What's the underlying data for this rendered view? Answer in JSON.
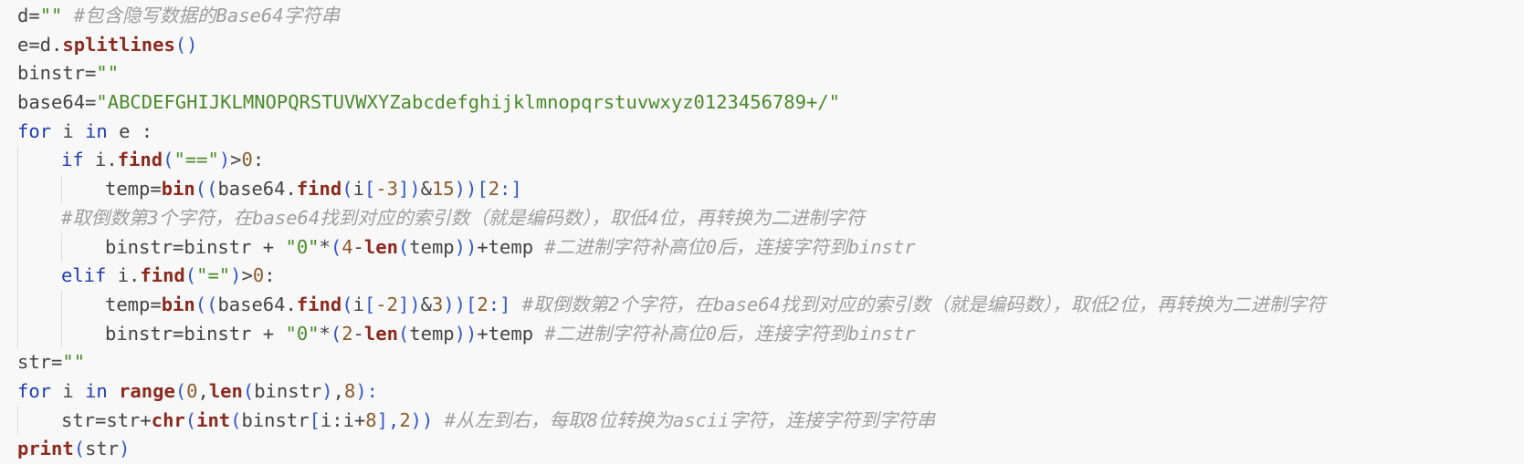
{
  "colors": {
    "background": "#f8f8f8",
    "keyword": "#1f3fb0",
    "function": "#8b2a1e",
    "string": "#4a8a2a",
    "number": "#8b5a2b",
    "comment": "#9e9e9e",
    "default": "#444444",
    "indent_guide": "#dcdcdc"
  },
  "lines": [
    {
      "indent": 0,
      "tokens": [
        {
          "t": "d=",
          "c": "default"
        },
        {
          "t": "\"\"",
          "c": "str"
        },
        {
          "t": " #包含隐写数据的Base64字符串",
          "c": "comment"
        }
      ]
    },
    {
      "indent": 0,
      "tokens": [
        {
          "t": "e=d.",
          "c": "default"
        },
        {
          "t": "splitlines",
          "c": "fn"
        },
        {
          "t": "()",
          "c": "paren"
        }
      ]
    },
    {
      "indent": 0,
      "tokens": [
        {
          "t": "binstr=",
          "c": "default"
        },
        {
          "t": "\"\"",
          "c": "str"
        }
      ]
    },
    {
      "indent": 0,
      "tokens": [
        {
          "t": "base64=",
          "c": "default"
        },
        {
          "t": "\"ABCDEFGHIJKLMNOPQRSTUVWXYZabcdefghijklmnopqrstuvwxyz0123456789+/\"",
          "c": "str"
        }
      ]
    },
    {
      "indent": 0,
      "tokens": [
        {
          "t": "for",
          "c": "kw"
        },
        {
          "t": " i ",
          "c": "default"
        },
        {
          "t": "in",
          "c": "kw"
        },
        {
          "t": " e :",
          "c": "default"
        }
      ]
    },
    {
      "indent": 1,
      "tokens": [
        {
          "t": "if",
          "c": "kw"
        },
        {
          "t": " i.",
          "c": "default"
        },
        {
          "t": "find",
          "c": "fn"
        },
        {
          "t": "(",
          "c": "paren"
        },
        {
          "t": "\"==\"",
          "c": "str"
        },
        {
          "t": ")",
          "c": "paren"
        },
        {
          "t": ">",
          "c": "default"
        },
        {
          "t": "0",
          "c": "num"
        },
        {
          "t": ":",
          "c": "default"
        }
      ]
    },
    {
      "indent": 2,
      "tokens": [
        {
          "t": "temp=",
          "c": "default"
        },
        {
          "t": "bin",
          "c": "builtin"
        },
        {
          "t": "((",
          "c": "paren"
        },
        {
          "t": "base64.",
          "c": "default"
        },
        {
          "t": "find",
          "c": "fn"
        },
        {
          "t": "(",
          "c": "paren"
        },
        {
          "t": "i",
          "c": "default"
        },
        {
          "t": "[",
          "c": "paren"
        },
        {
          "t": "-3",
          "c": "num"
        },
        {
          "t": "])",
          "c": "paren"
        },
        {
          "t": "&",
          "c": "default"
        },
        {
          "t": "15",
          "c": "num"
        },
        {
          "t": "))",
          "c": "paren"
        },
        {
          "t": "[",
          "c": "paren"
        },
        {
          "t": "2",
          "c": "num"
        },
        {
          "t": ":]",
          "c": "paren"
        }
      ]
    },
    {
      "indent": 1,
      "tokens": [
        {
          "t": "#取倒数第3个字符，在base64找到对应的索引数（就是编码数），取低4位，再转换为二进制字符",
          "c": "comment"
        }
      ]
    },
    {
      "indent": 2,
      "tokens": [
        {
          "t": "binstr=binstr + ",
          "c": "default"
        },
        {
          "t": "\"0\"",
          "c": "str"
        },
        {
          "t": "*",
          "c": "default"
        },
        {
          "t": "(",
          "c": "paren"
        },
        {
          "t": "4",
          "c": "num"
        },
        {
          "t": "-",
          "c": "default"
        },
        {
          "t": "len",
          "c": "builtin"
        },
        {
          "t": "(",
          "c": "paren"
        },
        {
          "t": "temp",
          "c": "default"
        },
        {
          "t": "))",
          "c": "paren"
        },
        {
          "t": "+temp ",
          "c": "default"
        },
        {
          "t": "#二进制字符补高位0后，连接字符到binstr",
          "c": "comment"
        }
      ]
    },
    {
      "indent": 1,
      "tokens": [
        {
          "t": "elif",
          "c": "kw"
        },
        {
          "t": " i.",
          "c": "default"
        },
        {
          "t": "find",
          "c": "fn"
        },
        {
          "t": "(",
          "c": "paren"
        },
        {
          "t": "\"=\"",
          "c": "str"
        },
        {
          "t": ")",
          "c": "paren"
        },
        {
          "t": ">",
          "c": "default"
        },
        {
          "t": "0",
          "c": "num"
        },
        {
          "t": ":",
          "c": "default"
        }
      ]
    },
    {
      "indent": 2,
      "tokens": [
        {
          "t": "temp=",
          "c": "default"
        },
        {
          "t": "bin",
          "c": "builtin"
        },
        {
          "t": "((",
          "c": "paren"
        },
        {
          "t": "base64.",
          "c": "default"
        },
        {
          "t": "find",
          "c": "fn"
        },
        {
          "t": "(",
          "c": "paren"
        },
        {
          "t": "i",
          "c": "default"
        },
        {
          "t": "[",
          "c": "paren"
        },
        {
          "t": "-2",
          "c": "num"
        },
        {
          "t": "])",
          "c": "paren"
        },
        {
          "t": "&",
          "c": "default"
        },
        {
          "t": "3",
          "c": "num"
        },
        {
          "t": "))",
          "c": "paren"
        },
        {
          "t": "[",
          "c": "paren"
        },
        {
          "t": "2",
          "c": "num"
        },
        {
          "t": ":]",
          "c": "paren"
        },
        {
          "t": " #取倒数第2个字符，在base64找到对应的索引数（就是编码数），取低2位，再转换为二进制字符",
          "c": "comment"
        }
      ]
    },
    {
      "indent": 2,
      "tokens": [
        {
          "t": "binstr=binstr + ",
          "c": "default"
        },
        {
          "t": "\"0\"",
          "c": "str"
        },
        {
          "t": "*",
          "c": "default"
        },
        {
          "t": "(",
          "c": "paren"
        },
        {
          "t": "2",
          "c": "num"
        },
        {
          "t": "-",
          "c": "default"
        },
        {
          "t": "len",
          "c": "builtin"
        },
        {
          "t": "(",
          "c": "paren"
        },
        {
          "t": "temp",
          "c": "default"
        },
        {
          "t": "))",
          "c": "paren"
        },
        {
          "t": "+temp ",
          "c": "default"
        },
        {
          "t": "#二进制字符补高位0后，连接字符到binstr",
          "c": "comment"
        }
      ]
    },
    {
      "indent": 0,
      "tokens": [
        {
          "t": "str=",
          "c": "default"
        },
        {
          "t": "\"\"",
          "c": "str"
        }
      ]
    },
    {
      "indent": 0,
      "tokens": [
        {
          "t": "for",
          "c": "kw"
        },
        {
          "t": " i ",
          "c": "default"
        },
        {
          "t": "in",
          "c": "kw"
        },
        {
          "t": " ",
          "c": "default"
        },
        {
          "t": "range",
          "c": "builtin"
        },
        {
          "t": "(",
          "c": "paren"
        },
        {
          "t": "0",
          "c": "num"
        },
        {
          "t": ",",
          "c": "default"
        },
        {
          "t": "len",
          "c": "builtin"
        },
        {
          "t": "(",
          "c": "paren"
        },
        {
          "t": "binstr",
          "c": "default"
        },
        {
          "t": ")",
          "c": "paren"
        },
        {
          "t": ",",
          "c": "default"
        },
        {
          "t": "8",
          "c": "num"
        },
        {
          "t": "):",
          "c": "paren"
        }
      ]
    },
    {
      "indent": 1,
      "tokens": [
        {
          "t": "str=str+",
          "c": "default"
        },
        {
          "t": "chr",
          "c": "builtin"
        },
        {
          "t": "(",
          "c": "paren"
        },
        {
          "t": "int",
          "c": "builtin"
        },
        {
          "t": "(",
          "c": "paren"
        },
        {
          "t": "binstr",
          "c": "default"
        },
        {
          "t": "[",
          "c": "paren"
        },
        {
          "t": "i:i+",
          "c": "default"
        },
        {
          "t": "8",
          "c": "num"
        },
        {
          "t": "],",
          "c": "paren"
        },
        {
          "t": "2",
          "c": "num"
        },
        {
          "t": "))",
          "c": "paren"
        },
        {
          "t": " #从左到右，每取8位转换为ascii字符，连接字符到字符串",
          "c": "comment"
        }
      ]
    },
    {
      "indent": 0,
      "tokens": [
        {
          "t": "print",
          "c": "builtin"
        },
        {
          "t": "(",
          "c": "paren"
        },
        {
          "t": "str",
          "c": "default"
        },
        {
          "t": ")",
          "c": "paren"
        }
      ]
    }
  ]
}
